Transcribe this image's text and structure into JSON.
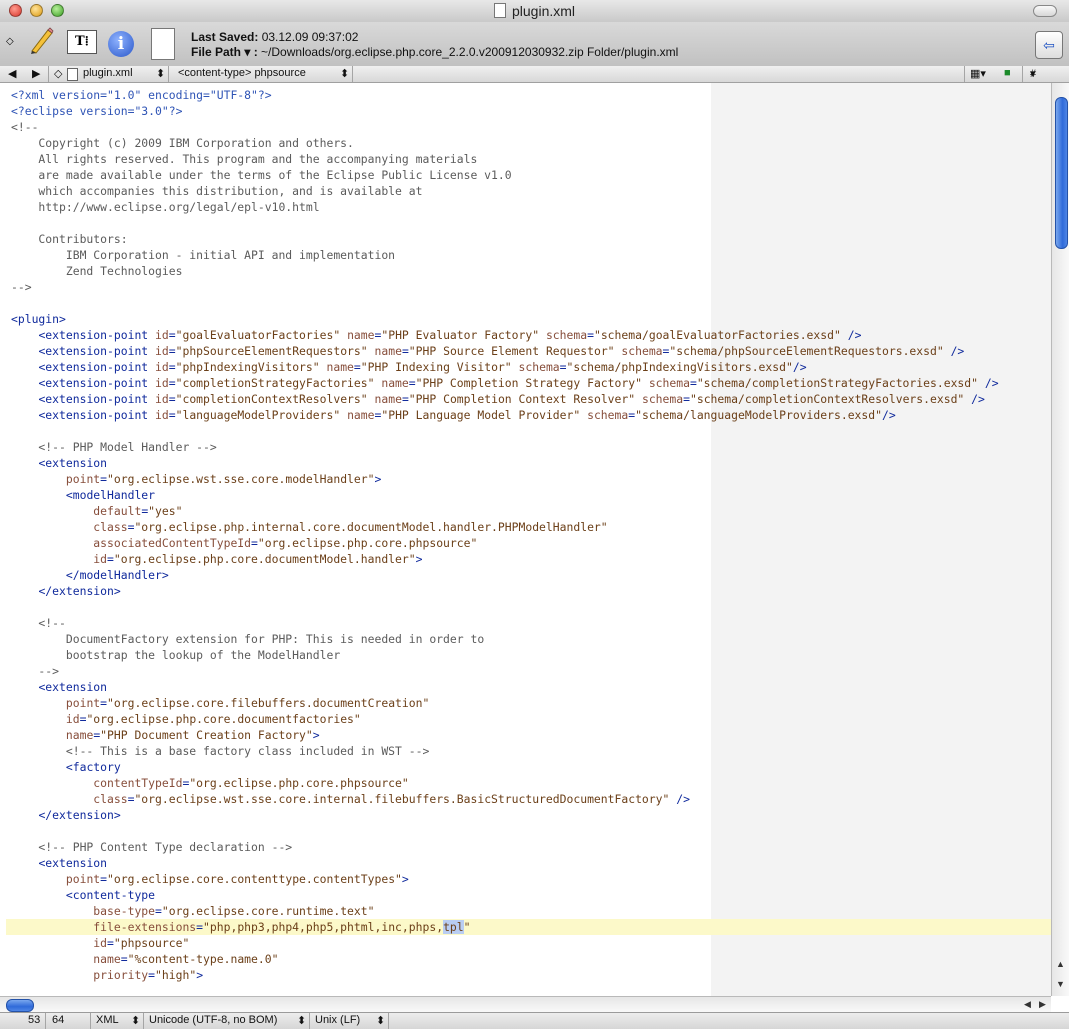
{
  "window": {
    "title": "plugin.xml"
  },
  "toolbar": {
    "last_saved_label": "Last Saved:",
    "last_saved_value": "03.12.09 09:37:02",
    "file_path_label": "File Path ▾ :",
    "file_path_value": "~/Downloads/org.eclipse.php.core_2.2.0.v200912030932.zip Folder/plugin.xml"
  },
  "navbar": {
    "file_popup": "plugin.xml",
    "symbol_popup": "<content-type> phpsource",
    "hash": "#"
  },
  "status": {
    "line": "53",
    "column": "64",
    "syntax": "XML",
    "encoding": "Unicode (UTF-8, no BOM)",
    "line_endings": "Unix (LF)"
  },
  "editor": {
    "current_line": 53,
    "selected_text": "tpl",
    "lines": [
      "<?xml version=\"1.0\" encoding=\"UTF-8\"?>",
      "<?eclipse version=\"3.0\"?>",
      "<!--",
      "    Copyright (c) 2009 IBM Corporation and others.",
      "    All rights reserved. This program and the accompanying materials",
      "    are made available under the terms of the Eclipse Public License v1.0",
      "    which accompanies this distribution, and is available at",
      "    http://www.eclipse.org/legal/epl-v10.html",
      "",
      "    Contributors:",
      "        IBM Corporation - initial API and implementation",
      "        Zend Technologies",
      "-->",
      "",
      "<plugin>",
      "    <extension-point id=\"goalEvaluatorFactories\" name=\"PHP Evaluator Factory\" schema=\"schema/goalEvaluatorFactories.exsd\" />",
      "    <extension-point id=\"phpSourceElementRequestors\" name=\"PHP Source Element Requestor\" schema=\"schema/phpSourceElementRequestors.exsd\" />",
      "    <extension-point id=\"phpIndexingVisitors\" name=\"PHP Indexing Visitor\" schema=\"schema/phpIndexingVisitors.exsd\"/>",
      "    <extension-point id=\"completionStrategyFactories\" name=\"PHP Completion Strategy Factory\" schema=\"schema/completionStrategyFactories.exsd\" />",
      "    <extension-point id=\"completionContextResolvers\" name=\"PHP Completion Context Resolver\" schema=\"schema/completionContextResolvers.exsd\" />",
      "    <extension-point id=\"languageModelProviders\" name=\"PHP Language Model Provider\" schema=\"schema/languageModelProviders.exsd\"/>",
      "",
      "    <!-- PHP Model Handler -->",
      "    <extension",
      "        point=\"org.eclipse.wst.sse.core.modelHandler\">",
      "        <modelHandler",
      "            default=\"yes\"",
      "            class=\"org.eclipse.php.internal.core.documentModel.handler.PHPModelHandler\"",
      "            associatedContentTypeId=\"org.eclipse.php.core.phpsource\"",
      "            id=\"org.eclipse.php.core.documentModel.handler\">",
      "        </modelHandler>",
      "    </extension>",
      "",
      "    <!--",
      "        DocumentFactory extension for PHP: This is needed in order to",
      "        bootstrap the lookup of the ModelHandler",
      "    -->",
      "    <extension",
      "        point=\"org.eclipse.core.filebuffers.documentCreation\"",
      "        id=\"org.eclipse.php.core.documentfactories\"",
      "        name=\"PHP Document Creation Factory\">",
      "        <!-- This is a base factory class included in WST -->",
      "        <factory",
      "            contentTypeId=\"org.eclipse.php.core.phpsource\"",
      "            class=\"org.eclipse.wst.sse.core.internal.filebuffers.BasicStructuredDocumentFactory\" />",
      "    </extension>",
      "",
      "    <!-- PHP Content Type declaration -->",
      "    <extension",
      "        point=\"org.eclipse.core.contenttype.contentTypes\">",
      "        <content-type",
      "            base-type=\"org.eclipse.core.runtime.text\"",
      "            file-extensions=\"php,php3,php4,php5,phtml,inc,phps,tpl\"",
      "            id=\"phpsource\"",
      "            name=\"%content-type.name.0\"",
      "            priority=\"high\">"
    ]
  }
}
